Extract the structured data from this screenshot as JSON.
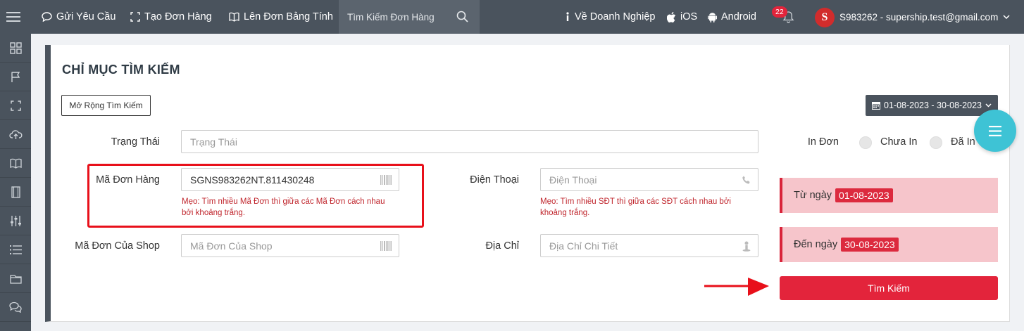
{
  "topbar": {
    "items": {
      "request": "Gửi Yêu Cầu",
      "create_order": "Tạo Đơn Hàng",
      "spreadsheet": "Lên Đơn Bảng Tính"
    },
    "search_placeholder": "Tìm Kiếm Đơn Hàng",
    "business": "Về Doanh Nghiệp",
    "ios": "iOS",
    "android": "Android",
    "notification_count": "22",
    "avatar_letter": "S",
    "account": "S983262 - supership.test@gmail.com"
  },
  "card": {
    "title": "CHỈ MỤC TÌM KIẾM",
    "expand_button": "Mở Rộng Tìm Kiếm",
    "date_range": "01-08-2023 - 30-08-2023"
  },
  "form": {
    "status_label": "Trạng Thái",
    "status_placeholder": "Trạng Thái",
    "order_code_label": "Mã Đơn Hàng",
    "order_code_value": "SGNS983262NT.811430248",
    "order_code_hint_line1": "Mẹo: Tìm nhiều Mã Đơn thì giữa các Mã Đơn cách nhau",
    "order_code_hint_line2": "bởi khoảng trắng.",
    "shop_code_label": "Mã Đơn Của Shop",
    "shop_code_placeholder": "Mã Đơn Của Shop",
    "phone_label": "Điện Thoại",
    "phone_placeholder": "Điện Thoại",
    "phone_hint_line1": "Mẹo: Tìm nhiều SĐT thì giữa các SĐT cách nhau bởi",
    "phone_hint_line2": "khoảng trắng.",
    "address_label": "Địa Chỉ",
    "address_placeholder": "Địa Chỉ Chi Tiết",
    "print_label": "In Đơn",
    "not_printed": "Chưa In",
    "printed": "Đã In",
    "from_label": "Từ ngày",
    "from_date": "01-08-2023",
    "to_label": "Đến ngày",
    "to_date": "30-08-2023",
    "search_button": "Tìm Kiếm"
  },
  "colors": {
    "topbar": "#4a535d",
    "accent_red": "#e3243b",
    "fab": "#3ec3d5"
  }
}
